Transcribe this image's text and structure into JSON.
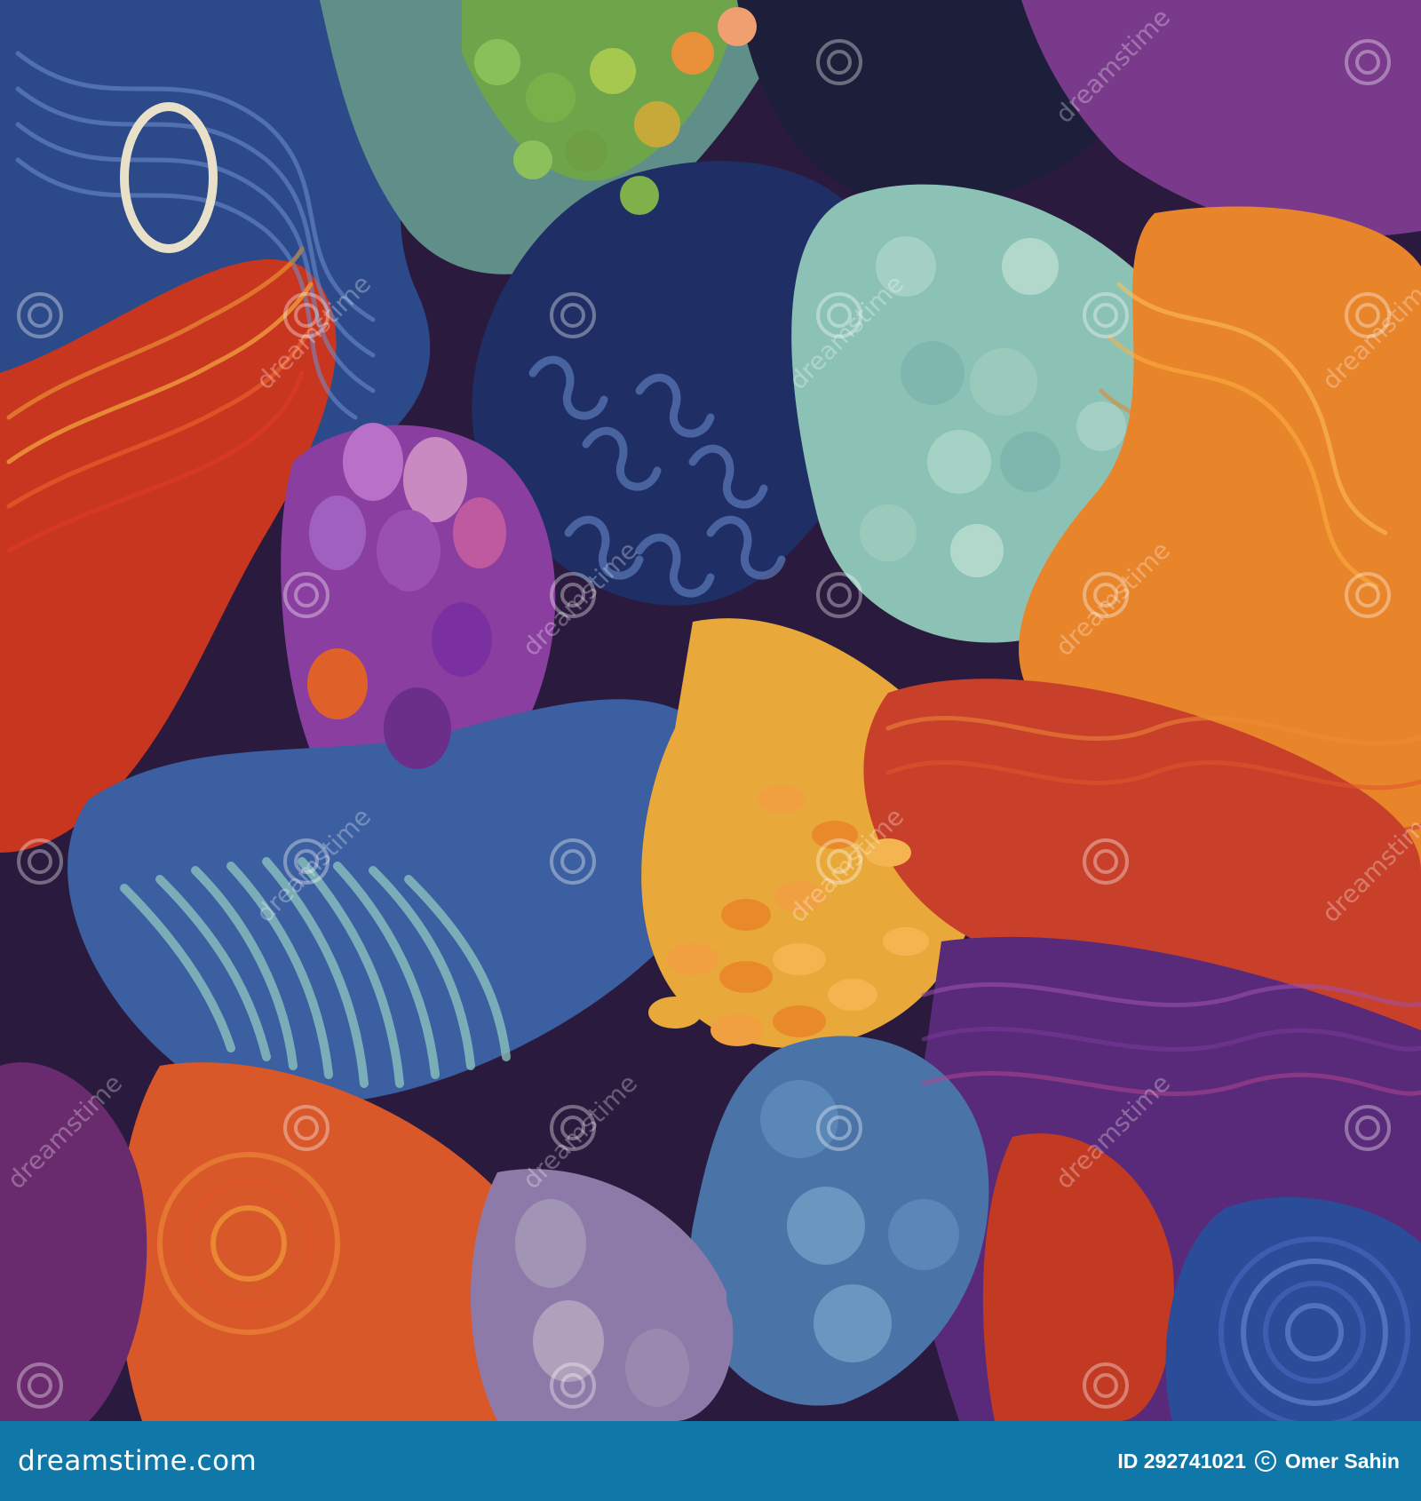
{
  "image": {
    "subject": "colorful textured yarn and felt art",
    "palette": {
      "navy": "#1f2f66",
      "blue": "#3b5fa0",
      "teal": "#7fb6ae",
      "green": "#6ea54a",
      "orange": "#e8842a",
      "red": "#c9361f",
      "purple": "#6b2f8a",
      "magenta": "#b0448e",
      "gold": "#e9a93a",
      "lavender": "#8e7aa8"
    }
  },
  "watermark": {
    "text": "dreamstime"
  },
  "footer": {
    "logo": "dreamstime.com",
    "id_label": "ID 292741021",
    "copyright_icon": "copyright-icon",
    "author": "Omer Sahin",
    "background": "#0f78a8"
  }
}
